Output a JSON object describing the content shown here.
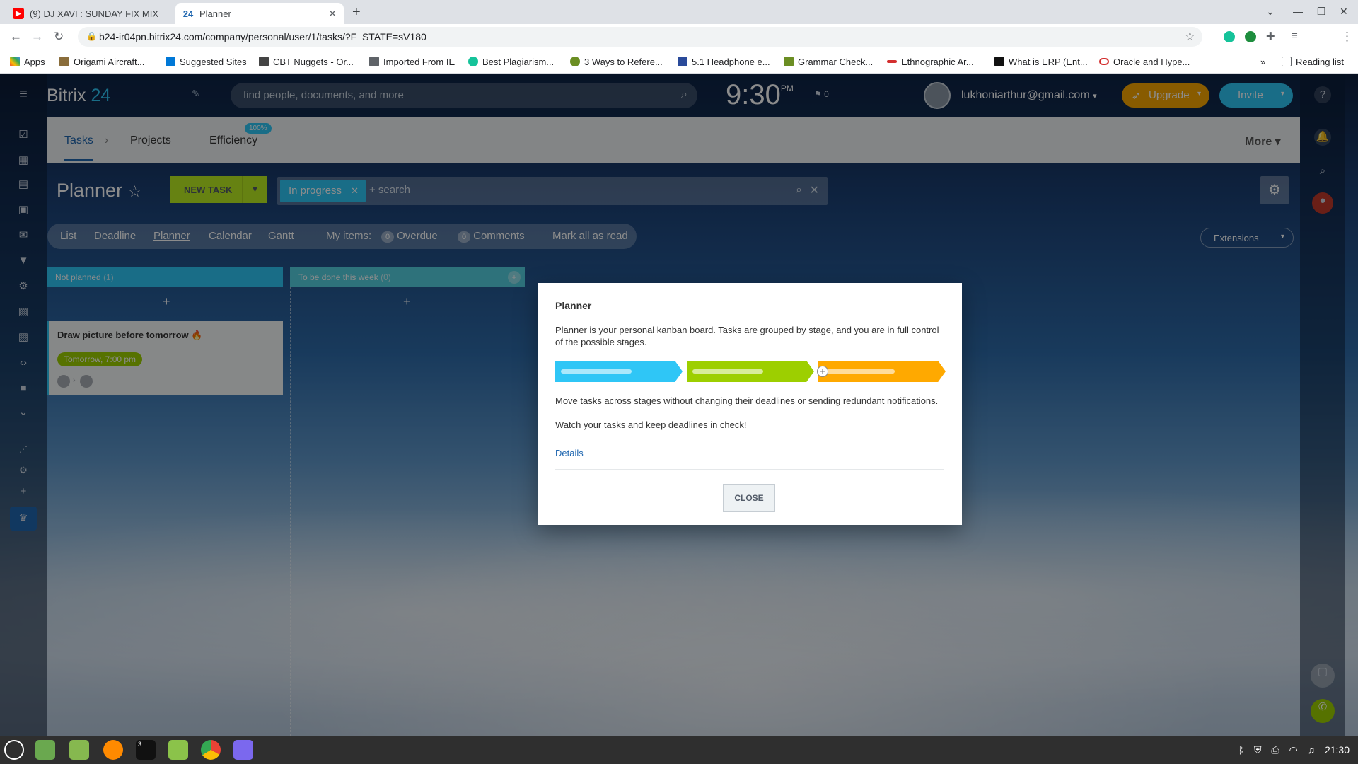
{
  "browser": {
    "tabs": [
      {
        "title": "(9) DJ XAVI : SUNDAY FIX MIX"
      },
      {
        "title": "Planner",
        "favicon_text": "24"
      }
    ],
    "url": "b24-ir04pn.bitrix24.com/company/personal/user/1/tasks/?F_STATE=sV180",
    "bookmarks": [
      {
        "label": "Apps"
      },
      {
        "label": "Origami Aircraft..."
      },
      {
        "label": "Suggested Sites"
      },
      {
        "label": "CBT Nuggets - Or..."
      },
      {
        "label": "Imported From IE"
      },
      {
        "label": "Best Plagiarism..."
      },
      {
        "label": "3 Ways to Refere..."
      },
      {
        "label": "5.1 Headphone e..."
      },
      {
        "label": "Grammar Check..."
      },
      {
        "label": "Ethnographic Ar..."
      },
      {
        "label": "What is ERP (Ent..."
      },
      {
        "label": "Oracle and Hype..."
      }
    ],
    "reading_list": "Reading list"
  },
  "header": {
    "logo_main": "Bitrix",
    "logo_num": "24",
    "search_placeholder": "find people, documents, and more",
    "time": "9:30",
    "ampm": "PM",
    "flag_count": "0",
    "user_email": "lukhoniarthur@gmail.com",
    "upgrade": "Upgrade",
    "invite": "Invite"
  },
  "topnav": {
    "tasks": "Tasks",
    "projects": "Projects",
    "efficiency": "Efficiency",
    "efficiency_badge": "100%",
    "more": "More"
  },
  "toolbar": {
    "title": "Planner",
    "new_task": "NEW TASK",
    "filter_chip": "In progress",
    "search_placeholder": "+ search"
  },
  "views": {
    "list": "List",
    "deadline": "Deadline",
    "planner": "Planner",
    "calendar": "Calendar",
    "gantt": "Gantt",
    "my_items": "My items:",
    "overdue_count": "0",
    "overdue": "Overdue",
    "comments_count": "0",
    "comments": "Comments",
    "mark_all": "Mark all as read",
    "extensions": "Extensions"
  },
  "columns": [
    {
      "title": "Not planned",
      "count": "(1)"
    },
    {
      "title": "To be done this week",
      "count": "(0)"
    }
  ],
  "card": {
    "title": "Draw picture before tomorrow",
    "deadline": "Tomorrow, 7:00 pm"
  },
  "modal": {
    "title": "Planner",
    "p1": "Planner is your personal kanban board. Tasks are grouped by stage, and you are in full control of the possible stages.",
    "p2": "Move tasks across stages without changing their deadlines or sending redundant notifications.",
    "p3": "Watch your tasks and keep deadlines in check!",
    "details": "Details",
    "close": "CLOSE",
    "stage_colors": [
      "#2fc6f6",
      "#9dcf00",
      "#ffa900"
    ]
  },
  "taskbar": {
    "time": "21:30",
    "terminal_badge": "3"
  }
}
